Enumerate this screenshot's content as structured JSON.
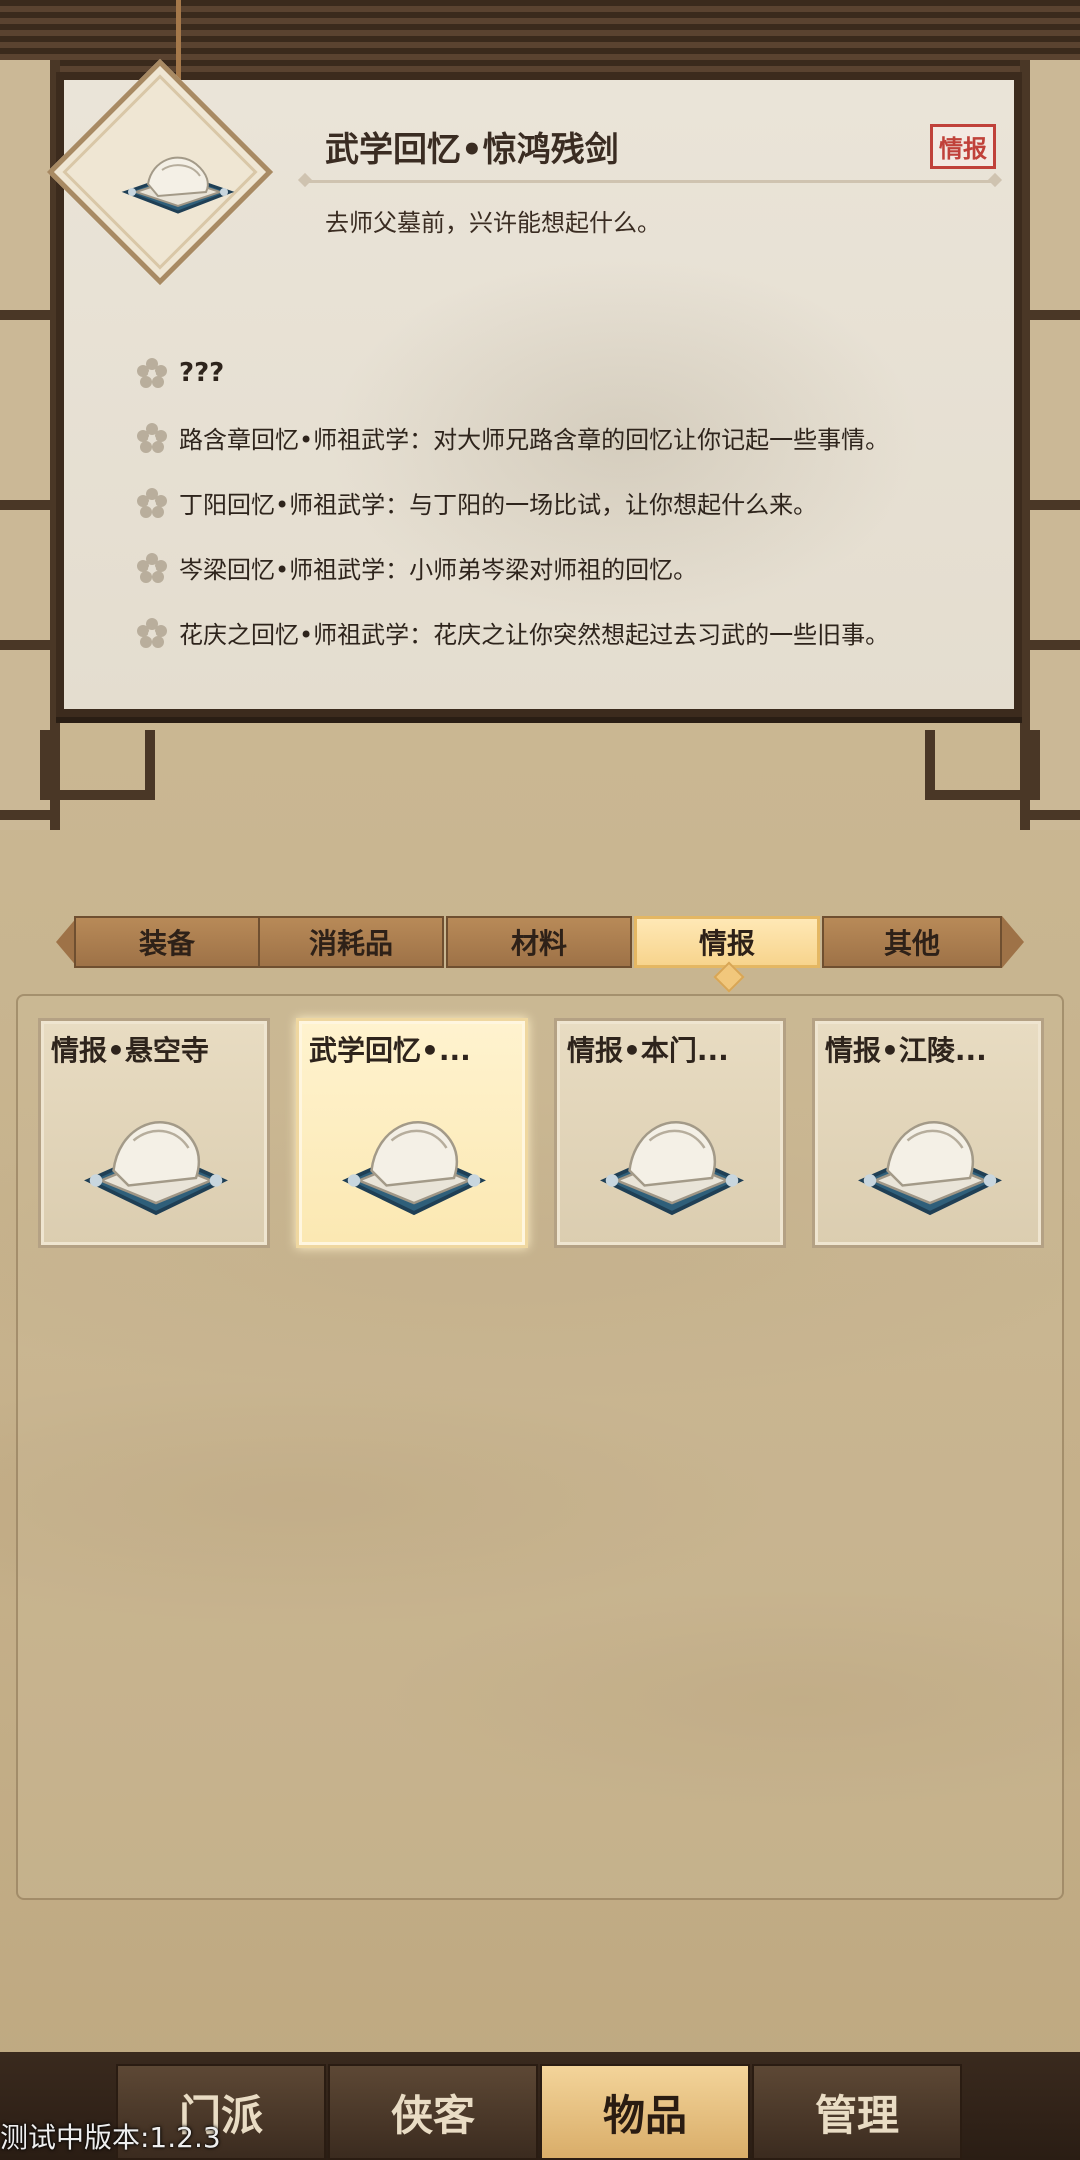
{
  "detail": {
    "title": "武学回忆•惊鸿残剑",
    "category_tag": "情报",
    "description": "去师父墓前，兴许能想起什么。",
    "clues": [
      "???",
      "路含章回忆•师祖武学：对大师兄路含章的回忆让你记起一些事情。",
      "丁阳回忆•师祖武学：与丁阳的一场比试，让你想起什么来。",
      "岑梁回忆•师祖武学：小师弟岑梁对师祖的回忆。",
      "花庆之回忆•师祖武学：花庆之让你突然想起过去习武的一些旧事。"
    ]
  },
  "tabs": [
    {
      "label": "装备"
    },
    {
      "label": "消耗品"
    },
    {
      "label": "材料"
    },
    {
      "label": "情报",
      "active": true
    },
    {
      "label": "其他"
    }
  ],
  "inventory": [
    {
      "name": "情报•悬空寺",
      "icon": "scroll-icon"
    },
    {
      "name": "武学回忆•...",
      "icon": "scroll-icon",
      "selected": true
    },
    {
      "name": "情报•本门...",
      "icon": "scroll-icon"
    },
    {
      "name": "情报•江陵...",
      "icon": "scroll-icon"
    }
  ],
  "nav": [
    {
      "label": "门派"
    },
    {
      "label": "侠客"
    },
    {
      "label": "物品",
      "active": true
    },
    {
      "label": "管理"
    }
  ],
  "version": "测试中版本:1.2.3",
  "colors": {
    "tag_red": "#c0413a",
    "active_tab": "#f7d48d",
    "frame_dark": "#3c2b1d"
  }
}
